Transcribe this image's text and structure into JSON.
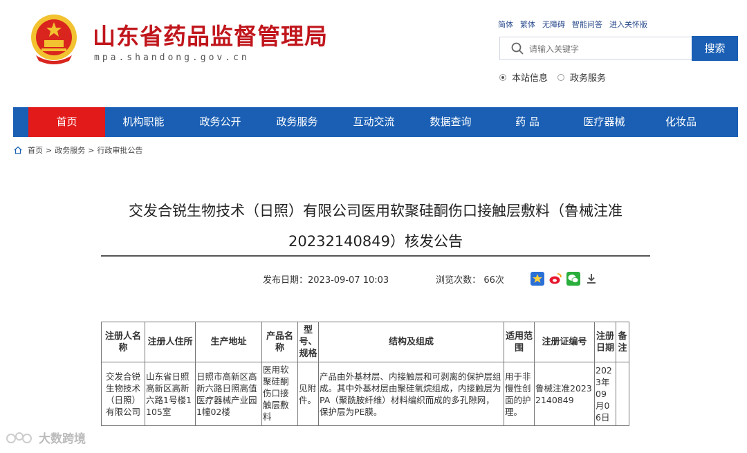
{
  "header": {
    "site_title": "山东省药品监督管理局",
    "site_domain": "mpa.shandong.gov.cn",
    "top_links": [
      "简体",
      "繁体",
      "无障碍",
      "智能问答",
      "进入关怀版"
    ],
    "search": {
      "placeholder": "请输入关键字",
      "button_label": "搜索"
    },
    "search_scope": [
      {
        "label": "本站信息",
        "selected": true
      },
      {
        "label": "政务服务",
        "selected": false
      }
    ]
  },
  "nav": {
    "items": [
      "首页",
      "机构职能",
      "政务公开",
      "政务服务",
      "互动交流",
      "数据查询",
      "药 品",
      "医疗器械",
      "化妆品"
    ],
    "active_index": 0
  },
  "breadcrumb": [
    "首页",
    "政务服务",
    "行政审批公告"
  ],
  "article": {
    "title": "交发合锐生物技术（日照）有限公司医用软聚硅酮伤口接触层敷料（鲁械注准20232140849）核发公告",
    "publish_label": "发布日期：",
    "publish_date": "2023-09-07 10:03",
    "views_label": "浏览次数：",
    "views": "66次"
  },
  "table": {
    "headers": [
      "注册人名称",
      "注册人住所",
      "生产地址",
      "产品名称",
      "型号、规格",
      "结构及组成",
      "适用范围",
      "注册证编号",
      "注册日期",
      "备注"
    ],
    "rows": [
      [
        "交发合锐生物技术（日照）有限公司",
        "山东省日照高新区高新六路1号楼1105室",
        "日照市高新区高新六路日照高值医疗器械产业园1幢02楼",
        "医用软聚硅酮伤口接触层敷料",
        "见附件。",
        "产品由外基材层、内接触层和可剥离的保护层组成。其中外基材层由聚硅氧烷组成，内接触层为PA（聚酰胺纤维）材料编织而成的多孔隙网，保护层为PE膜。",
        "用于非慢性创面的护理。",
        "鲁械注准20232140849",
        "2023年09月06日",
        ""
      ]
    ]
  },
  "watermark": "大数跨境",
  "colors": {
    "brand_red": "#c0161c",
    "nav_blue": "#1a5fb4",
    "nav_active": "#e21a1a"
  }
}
